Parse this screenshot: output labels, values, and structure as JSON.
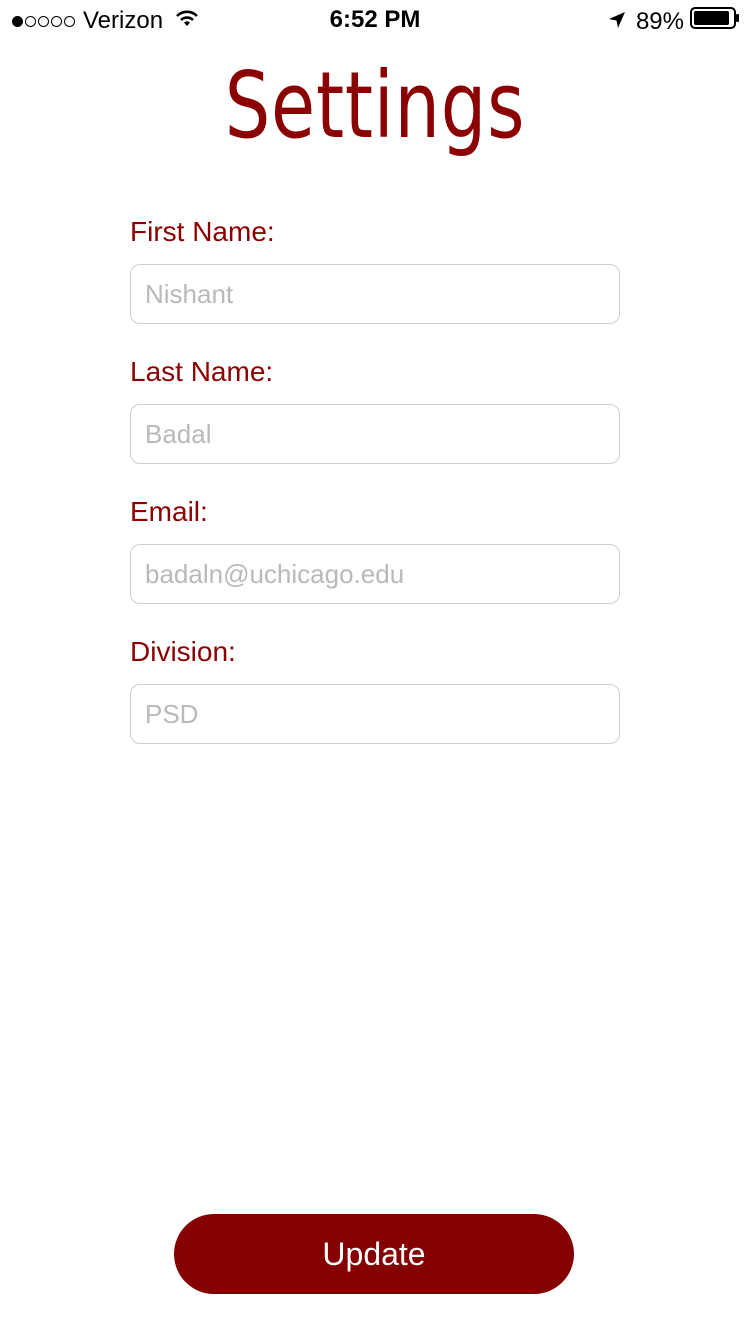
{
  "status_bar": {
    "carrier": "Verizon",
    "signal_bars_filled": 1,
    "signal_bars_total": 5,
    "time": "6:52 PM",
    "battery_percent": "89%",
    "icons": [
      "wifi-icon",
      "location-arrow-icon",
      "battery-icon"
    ]
  },
  "header": {
    "title": "Settings"
  },
  "form": {
    "first_name": {
      "label": "First Name:",
      "placeholder": "Nishant"
    },
    "last_name": {
      "label": "Last Name:",
      "placeholder": "Badal"
    },
    "email": {
      "label": "Email:",
      "placeholder": "badaln@uchicago.edu"
    },
    "division": {
      "label": "Division:",
      "placeholder": "PSD"
    }
  },
  "actions": {
    "update_label": "Update"
  },
  "colors": {
    "accent": "#8b0000",
    "button": "#850000",
    "placeholder": "#b9b9b9",
    "input_border": "#cfcfcf"
  }
}
